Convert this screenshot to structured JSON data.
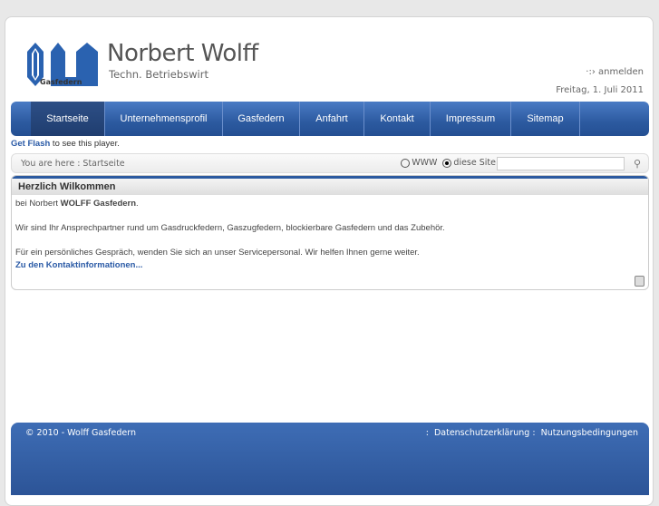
{
  "header": {
    "brand": "Norbert Wolff",
    "subtitle": "Techn. Betriebswirt",
    "logo_text": "Gasfedern",
    "login": "anmelden",
    "date": "Freitag, 1. Juli 2011"
  },
  "nav": {
    "items": [
      "Startseite",
      "Unternehmensprofil",
      "Gasfedern",
      "Anfahrt",
      "Kontakt",
      "Impressum",
      "Sitemap"
    ]
  },
  "flash": {
    "link": "Get Flash",
    "text": " to see this player."
  },
  "breadcrumb": {
    "text": "You are here : Startseite"
  },
  "search": {
    "opt_www": "WWW",
    "opt_site": "diese Site",
    "value": ""
  },
  "content": {
    "title": "Herzlich Wilkommen",
    "line1_pre": "bei Norbert ",
    "line1_bold": "WOLFF Gasfedern",
    "line1_post": ".",
    "para2": "Wir sind Ihr Ansprechpartner rund um Gasdruckfedern, Gaszugfedern, blockierbare Gasfedern und das Zubehör.",
    "para3": "Für ein persönliches Gespräch, wenden Sie sich an unser Servicepersonal. Wir helfen Ihnen gerne weiter.",
    "link": "Zu den Kontaktinformationen..."
  },
  "footer": {
    "copyright": "© 2010 - Wolff Gasfedern",
    "sep": ":",
    "privacy": "Datenschutzerklärung",
    "terms": "Nutzungsbedingungen"
  }
}
